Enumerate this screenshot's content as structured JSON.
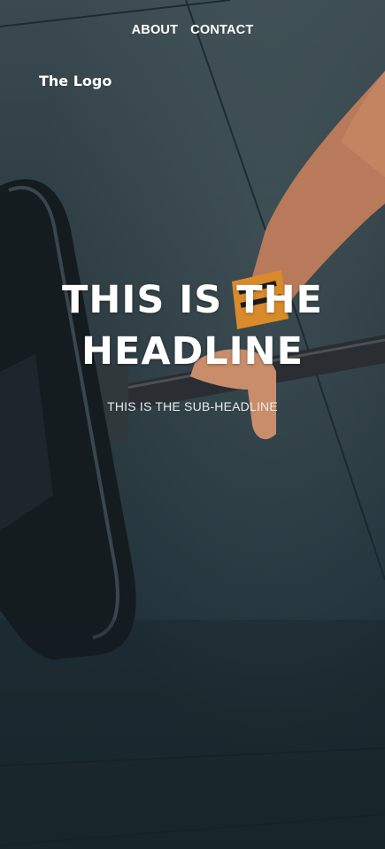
{
  "nav": {
    "items": [
      {
        "label": "ABOUT"
      },
      {
        "label": "CONTACT"
      }
    ]
  },
  "logo": {
    "text": "The Logo"
  },
  "hero": {
    "headline": "THIS IS THE HEADLINE",
    "subheadline": "THIS IS THE SUB-HEADLINE",
    "background_icon": "barbell-photo"
  },
  "colors": {
    "text": "#ffffff",
    "background": "#2b3a40",
    "wrist_wrap": "#d98a2b"
  }
}
